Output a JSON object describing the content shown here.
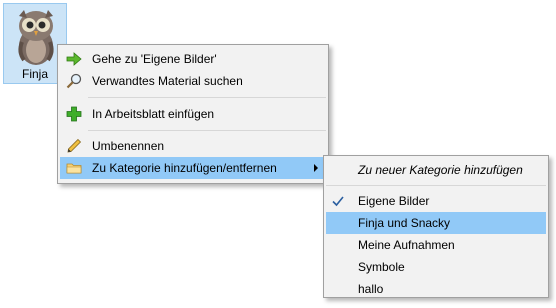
{
  "file": {
    "caption": "Finja",
    "icon": "owl-thumbnail"
  },
  "context_menu": {
    "items": [
      {
        "label": "Gehe zu 'Eigene Bilder'",
        "icon": "green-arrow-right-icon"
      },
      {
        "label": "Verwandtes Material suchen",
        "icon": "magnifier-icon"
      },
      {
        "label": "In Arbeitsblatt einfügen",
        "icon": "green-plus-icon"
      },
      {
        "label": "Umbenennen",
        "icon": "pencil-icon"
      },
      {
        "label": "Zu Kategorie hinzufügen/entfernen",
        "icon": "folder-icon",
        "highlighted": true,
        "has_submenu": true
      }
    ]
  },
  "submenu": {
    "new_category_label": "Zu neuer Kategorie hinzufügen",
    "categories": [
      {
        "label": "Eigene Bilder",
        "checked": true
      },
      {
        "label": "Finja und Snacky",
        "highlighted": true
      },
      {
        "label": "Meine Aufnahmen"
      },
      {
        "label": "Symbole"
      },
      {
        "label": "hallo"
      }
    ]
  },
  "colors": {
    "highlight": "#91c9f7",
    "menu_background": "#f2f2f2",
    "selection_tile": "#cce4f7"
  }
}
